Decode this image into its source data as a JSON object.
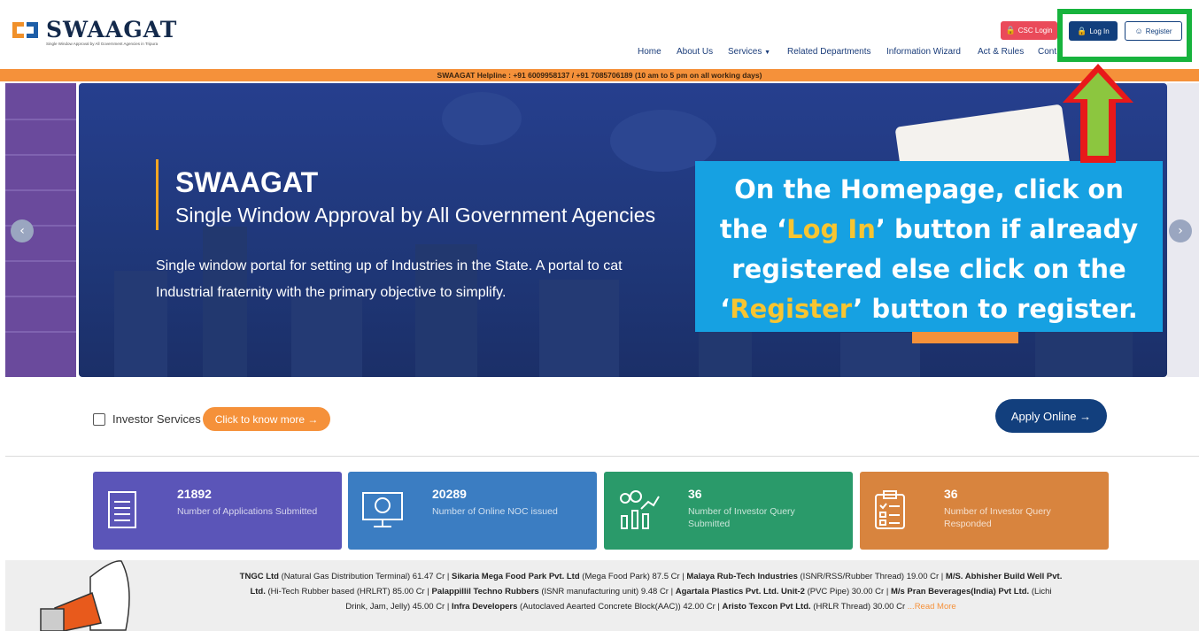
{
  "header": {
    "logo_title": "SWAAGAT",
    "logo_subtitle": "Single Window Approval by All Government Agencies in Tripura",
    "csc_login": "CSC Login",
    "login": "Log In",
    "register": "Register",
    "nav": [
      "Home",
      "About Us",
      "Services",
      "Related Departments",
      "Information Wizard",
      "Act & Rules",
      "Cont"
    ]
  },
  "helpline": "SWAAGAT Helpline : +91 6009958137 / +91 7085706189 (10 am to 5 pm on all working days)",
  "hero": {
    "title": "SWAAGAT",
    "subtitle": "Single Window Approval by All Government Agencies",
    "desc_line1": "Single window portal for setting up of Industries in the State. A portal to cat",
    "desc_line2": "Industrial fraternity with the primary objective to simplify."
  },
  "callout": {
    "line1": "On the Homepage, click on",
    "line2_pre": "the ‘",
    "line2_hl": "Log In",
    "line2_post": "’ button if already",
    "line3": "registered else click on the",
    "line4_pre": "‘",
    "line4_hl": "Register",
    "line4_post": "’ button to register."
  },
  "investor": {
    "label": "Investor Services",
    "know_more": "Click to know more  →",
    "apply_online": "Apply Online  →"
  },
  "stats": [
    {
      "value": "21892",
      "label": "Number of Applications Submitted",
      "color": "#5b55b8",
      "icon": "document-list-icon"
    },
    {
      "value": "20289",
      "label": "Number of Online NOC issued",
      "color": "#3b7dc2",
      "icon": "monitor-certificate-icon"
    },
    {
      "value": "36",
      "label": "Number of Investor Query Submitted",
      "color": "#2a9a6a",
      "icon": "investor-growth-icon"
    },
    {
      "value": "36",
      "label": "Number of Investor Query Responded",
      "color": "#d8843e",
      "icon": "clipboard-checklist-icon"
    }
  ],
  "ticker": {
    "items": [
      {
        "name": "TNGC Ltd",
        "detail": " (Natural Gas Distribution Terminal) 61.47 Cr | "
      },
      {
        "name": "Sikaria Mega Food Park Pvt. Ltd",
        "detail": " (Mega Food Park) 87.5 Cr | "
      },
      {
        "name": "Malaya Rub-Tech Industries",
        "detail": " (ISNR/RSS/Rubber Thread) 19.00 Cr | "
      },
      {
        "name": "M/S. Abhisher Build Well Pvt. Ltd.",
        "detail": " (Hi-Tech Rubber based (HRLRT) 85.00 Cr | "
      },
      {
        "name": "Palappillil Techno Rubbers",
        "detail": " (ISNR manufacturing unit) 9.48 Cr | "
      },
      {
        "name": "Agartala Plastics Pvt. Ltd. Unit-2",
        "detail": " (PVC Pipe) 30.00 Cr | "
      },
      {
        "name": "M/s Pran Beverages(India) Pvt Ltd.",
        "detail": " (Lichi Drink, Jam, Jelly) 45.00 Cr | "
      },
      {
        "name": "Infra Developers",
        "detail": " (Autoclaved Aearted Concrete Block(AAC)) 42.00 Cr | "
      },
      {
        "name": "Aristo Texcon Pvt Ltd.",
        "detail": " (HRLR Thread) 30.00 Cr "
      }
    ],
    "read_more": "...Read More"
  }
}
